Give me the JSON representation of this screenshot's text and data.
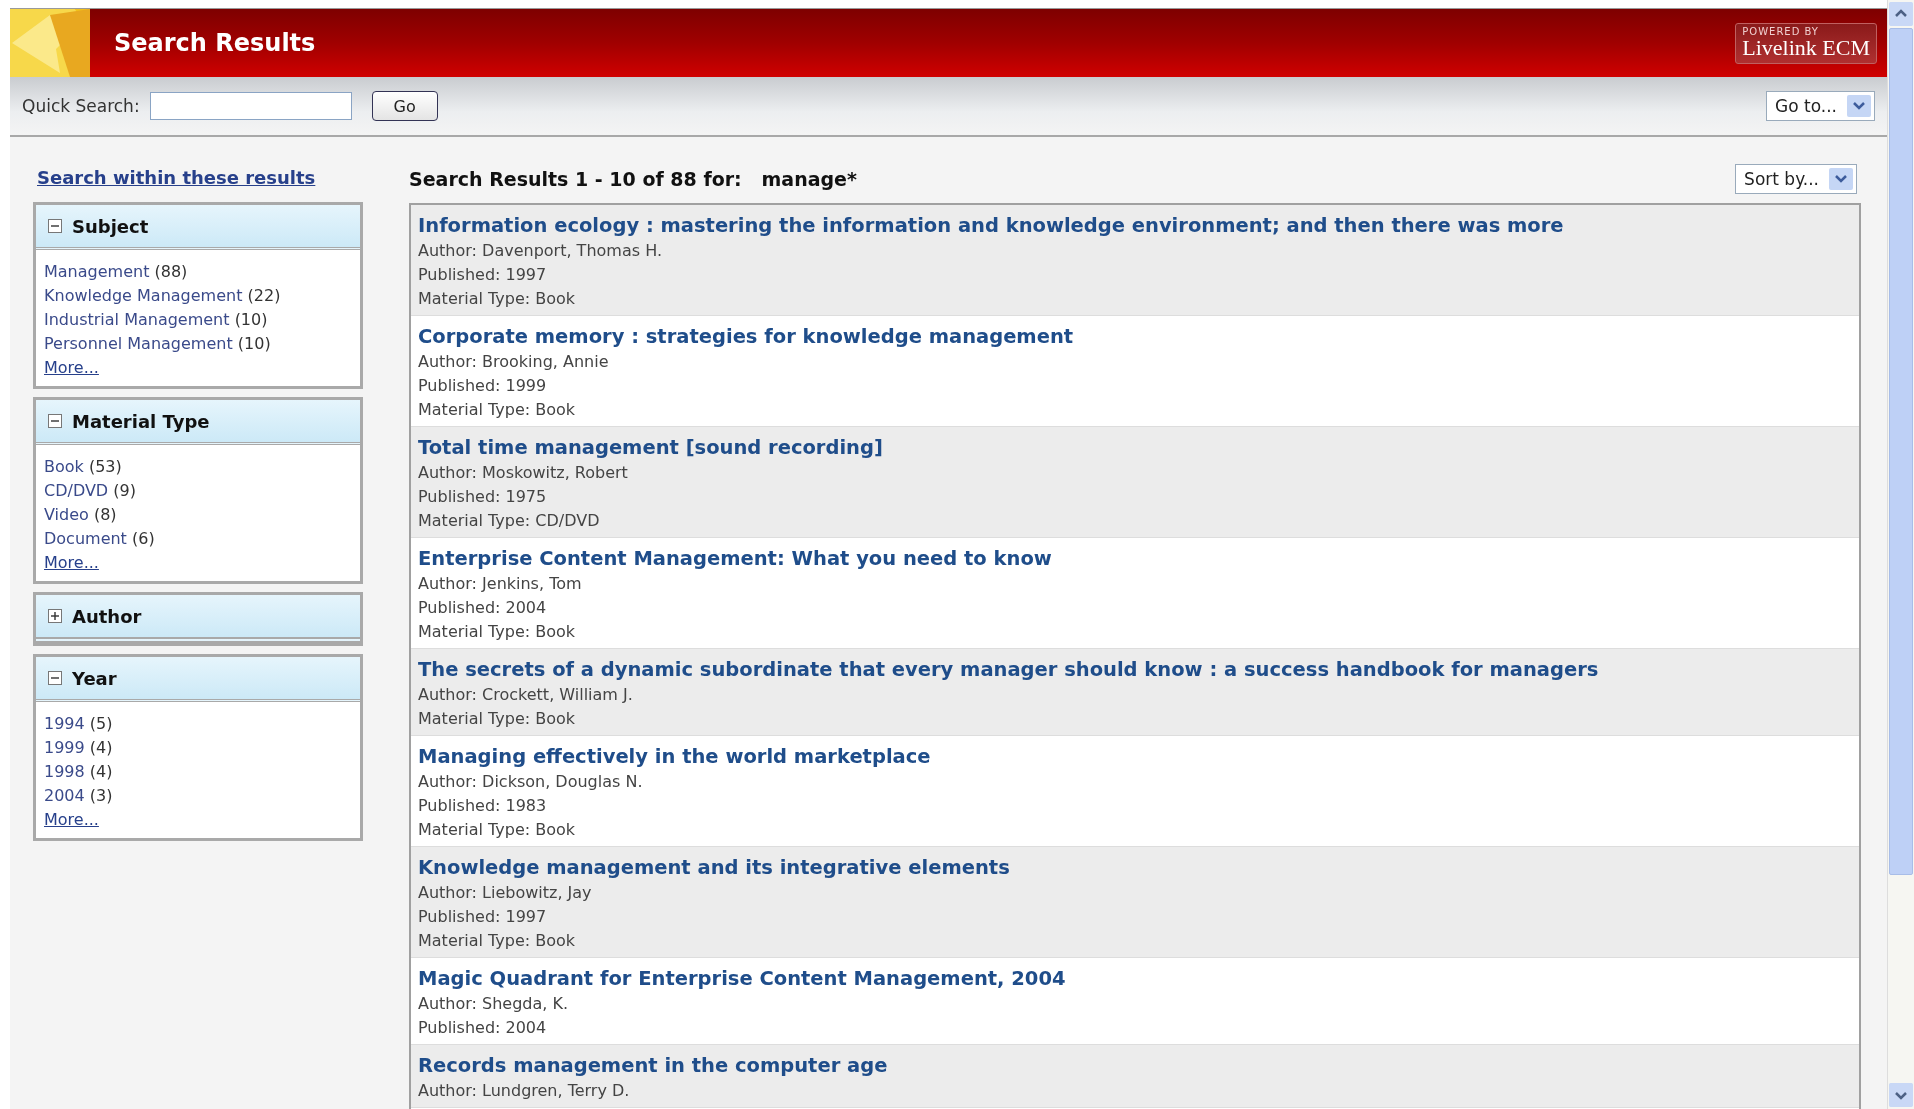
{
  "header": {
    "title": "Search Results",
    "badge_top": "POWERED BY",
    "badge_brand": "Livelink ECM"
  },
  "toolbar": {
    "search_label": "Quick Search:",
    "go_button": "Go",
    "goto_select": "Go to..."
  },
  "sidebar": {
    "refine_link": "Search within these results",
    "facets": [
      {
        "title": "Subject",
        "expanded": true,
        "items": [
          {
            "label": "Management",
            "count": "(88)"
          },
          {
            "label": "Knowledge Management",
            "count": "(22)"
          },
          {
            "label": "Industrial Management",
            "count": "(10)"
          },
          {
            "label": "Personnel Management",
            "count": "(10)"
          }
        ],
        "more": "More..."
      },
      {
        "title": "Material Type",
        "expanded": true,
        "items": [
          {
            "label": "Book",
            "count": "(53)"
          },
          {
            "label": "CD/DVD",
            "count": "(9)"
          },
          {
            "label": "Video",
            "count": "(8)"
          },
          {
            "label": "Document",
            "count": "(6)"
          }
        ],
        "more": "More..."
      },
      {
        "title": "Author",
        "expanded": false
      },
      {
        "title": "Year",
        "expanded": true,
        "items": [
          {
            "label": "1994",
            "count": "(5)"
          },
          {
            "label": "1999",
            "count": "(4)"
          },
          {
            "label": "1998",
            "count": "(4)"
          },
          {
            "label": "2004",
            "count": "(3)"
          }
        ],
        "more": "More..."
      }
    ]
  },
  "results": {
    "summary": "Search Results 1 - 10 of 88 for:",
    "query": "manage*",
    "sort_select": "Sort by...",
    "items": [
      {
        "title": "Information ecology : mastering the information and knowledge environment; and then there was more",
        "lines": [
          "Author: Davenport, Thomas H.",
          "Published: 1997",
          "Material Type: Book"
        ]
      },
      {
        "title": "Corporate memory : strategies for knowledge management",
        "lines": [
          "Author: Brooking, Annie",
          "Published: 1999",
          "Material Type: Book"
        ]
      },
      {
        "title": "Total time management [sound recording]",
        "lines": [
          "Author: Moskowitz, Robert",
          "Published: 1975",
          "Material Type: CD/DVD"
        ]
      },
      {
        "title": "Enterprise Content Management: What you need to know",
        "lines": [
          "Author: Jenkins, Tom",
          "Published: 2004",
          "Material Type: Book"
        ]
      },
      {
        "title": "The secrets of a dynamic subordinate that every manager should know : a success handbook for managers",
        "lines": [
          "Author: Crockett, William J.",
          "Material Type: Book"
        ]
      },
      {
        "title": "Managing effectively in the world marketplace",
        "lines": [
          "Author: Dickson, Douglas N.",
          "Published: 1983",
          "Material Type: Book"
        ]
      },
      {
        "title": "Knowledge management and its integrative elements",
        "lines": [
          "Author: Liebowitz, Jay",
          "Published: 1997",
          "Material Type: Book"
        ]
      },
      {
        "title": "Magic Quadrant for Enterprise Content Management, 2004",
        "lines": [
          "Author: Shegda, K.",
          "Published: 2004"
        ]
      },
      {
        "title": "Records management in the computer age",
        "lines": [
          "Author: Lundgren, Terry D."
        ]
      }
    ]
  }
}
